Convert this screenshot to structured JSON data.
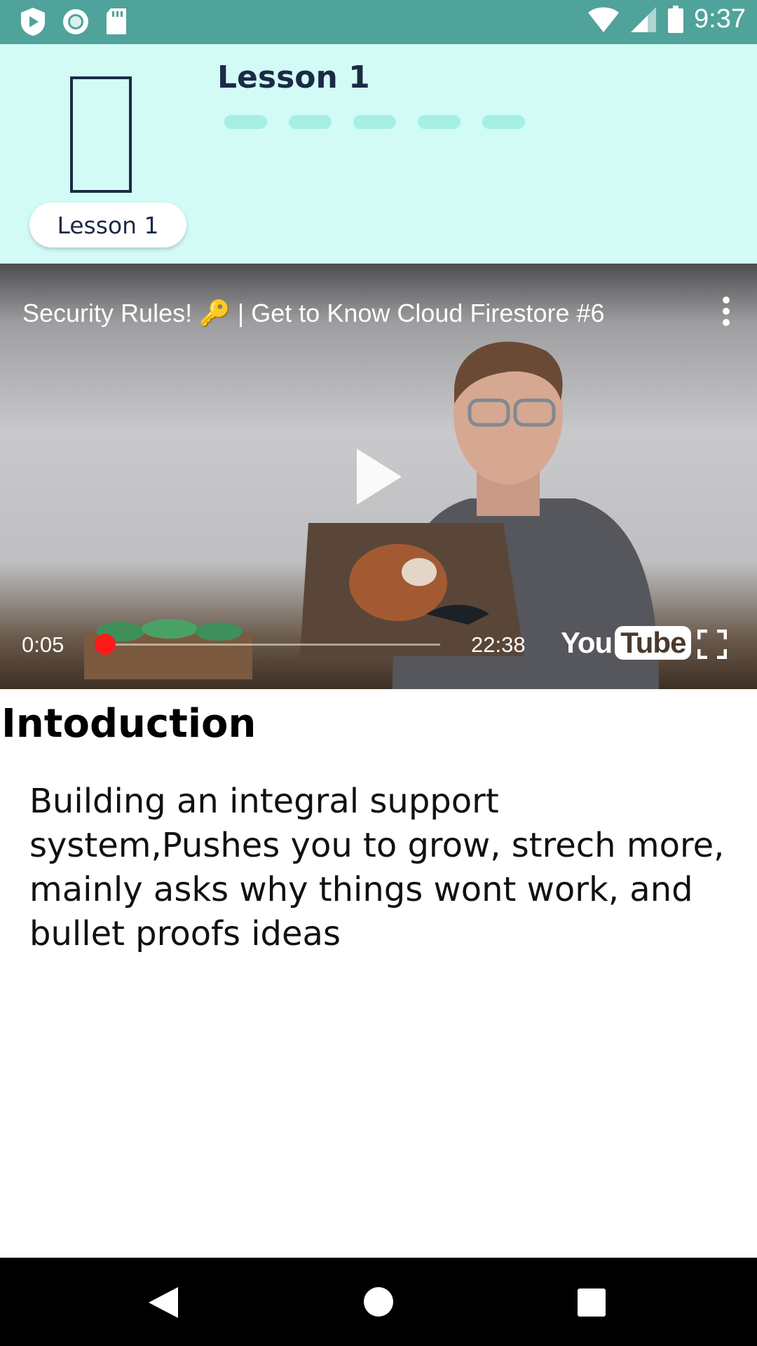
{
  "status_bar": {
    "time": "9:37",
    "left_icons": [
      "play-protect-icon",
      "record-icon",
      "sd-card-icon"
    ],
    "right_icons": [
      "wifi-icon",
      "signal-icon",
      "battery-icon"
    ],
    "background": "#4fa39a"
  },
  "header": {
    "title": "Lesson 1",
    "pill_label": "Lesson 1",
    "background": "#d2fbf6",
    "dot_count": 5
  },
  "video": {
    "title": "Security Rules! 🔑 | Get to Know Cloud Firestore #6",
    "current_time": "0:05",
    "total_time": "22:38",
    "progress_fraction": 0.004,
    "logo_you": "You",
    "logo_tube": "Tube",
    "progress_color": "#ff1a1a"
  },
  "content": {
    "heading": "Intoduction",
    "body": "Building an integral support system,Pushes you to grow, strech more, mainly asks why things wont work, and bullet proofs ideas"
  },
  "nav_bar": {
    "icons": [
      "back-icon",
      "home-icon",
      "recents-icon"
    ]
  }
}
